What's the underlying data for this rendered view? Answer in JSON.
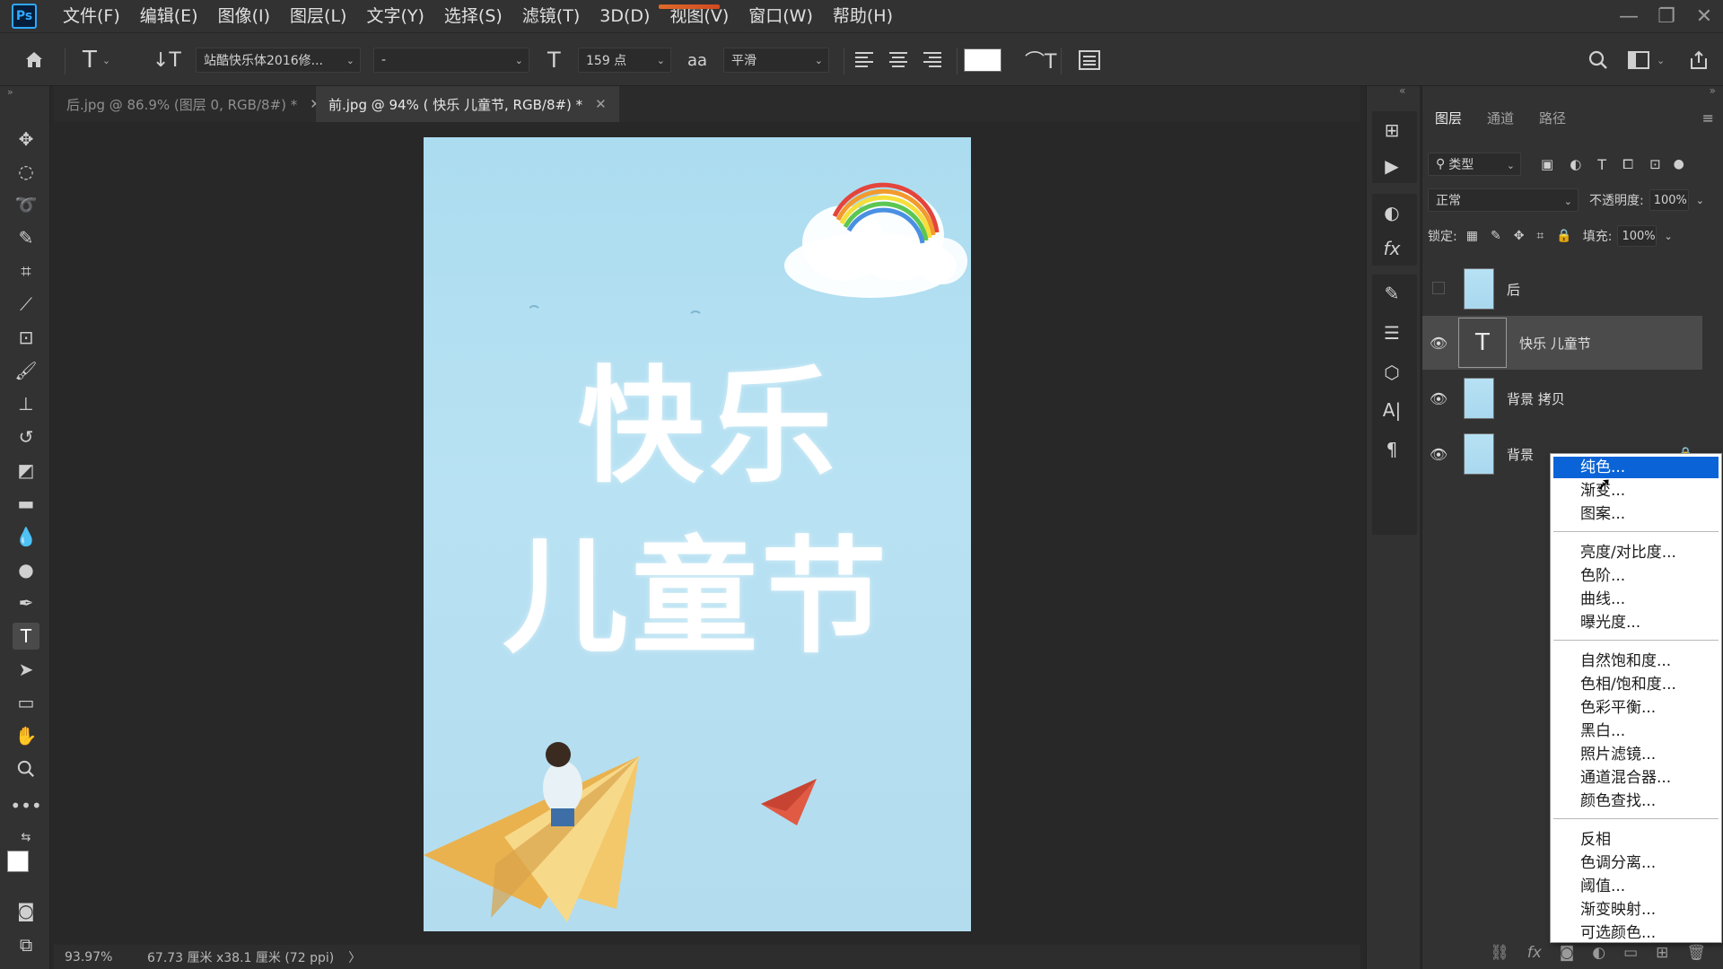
{
  "app": {
    "logo": "Ps"
  },
  "menubar": {
    "items": [
      "文件(F)",
      "编辑(E)",
      "图像(I)",
      "图层(L)",
      "文字(Y)",
      "选择(S)",
      "滤镜(T)",
      "3D(D)",
      "视图(V)",
      "窗口(W)",
      "帮助(H)"
    ],
    "window_controls": {
      "minimize": "—",
      "restore": "❐",
      "close": "✕"
    }
  },
  "options_bar": {
    "font_family": "站酷快乐体2016修...",
    "font_style": "-",
    "font_size": "159 点",
    "aa_glyph": "aa",
    "antialias": "平滑",
    "text_color": "#ffffff"
  },
  "tabs": [
    {
      "label": "后.jpg @ 86.9% (图层 0, RGB/8#) *",
      "active": false,
      "close": "✕"
    },
    {
      "label": "前.jpg @ 94% ( 快乐 儿童节, RGB/8#) *",
      "active": true,
      "close": "✕"
    }
  ],
  "document": {
    "line1": "快乐",
    "line2": "儿童节",
    "background": "#b3dcef"
  },
  "status": {
    "zoom": "93.97%",
    "size": "67.73 厘米 x38.1 厘米 (72 ppi)",
    "arrow": "〉"
  },
  "layers_panel": {
    "tabs": [
      "图层",
      "通道",
      "路径"
    ],
    "filter_label": "类型",
    "blend_mode": "正常",
    "opacity_label": "不透明度:",
    "opacity_value": "100%",
    "lock_label": "锁定:",
    "fill_label": "填充:",
    "fill_value": "100%",
    "layers": [
      {
        "name": "后",
        "visible": false,
        "selected": false,
        "kind": "image"
      },
      {
        "name": "快乐 儿童节",
        "visible": true,
        "selected": true,
        "kind": "text"
      },
      {
        "name": "背景 拷贝",
        "visible": true,
        "selected": false,
        "kind": "image"
      },
      {
        "name": "背景",
        "visible": true,
        "selected": false,
        "kind": "image"
      }
    ]
  },
  "context_menu": {
    "groups": [
      [
        "纯色...",
        "渐变...",
        "图案..."
      ],
      [
        "亮度/对比度...",
        "色阶...",
        "曲线...",
        "曝光度..."
      ],
      [
        "自然饱和度...",
        "色相/饱和度...",
        "色彩平衡...",
        "黑白...",
        "照片滤镜...",
        "通道混合器...",
        "颜色查找..."
      ],
      [
        "反相",
        "色调分离...",
        "阈值...",
        "渐变映射...",
        "可选颜色..."
      ]
    ],
    "highlighted": "纯色..."
  },
  "colors": {
    "accent": "#31a8ff",
    "highlight": "#0a64d8",
    "panel": "#323232"
  }
}
